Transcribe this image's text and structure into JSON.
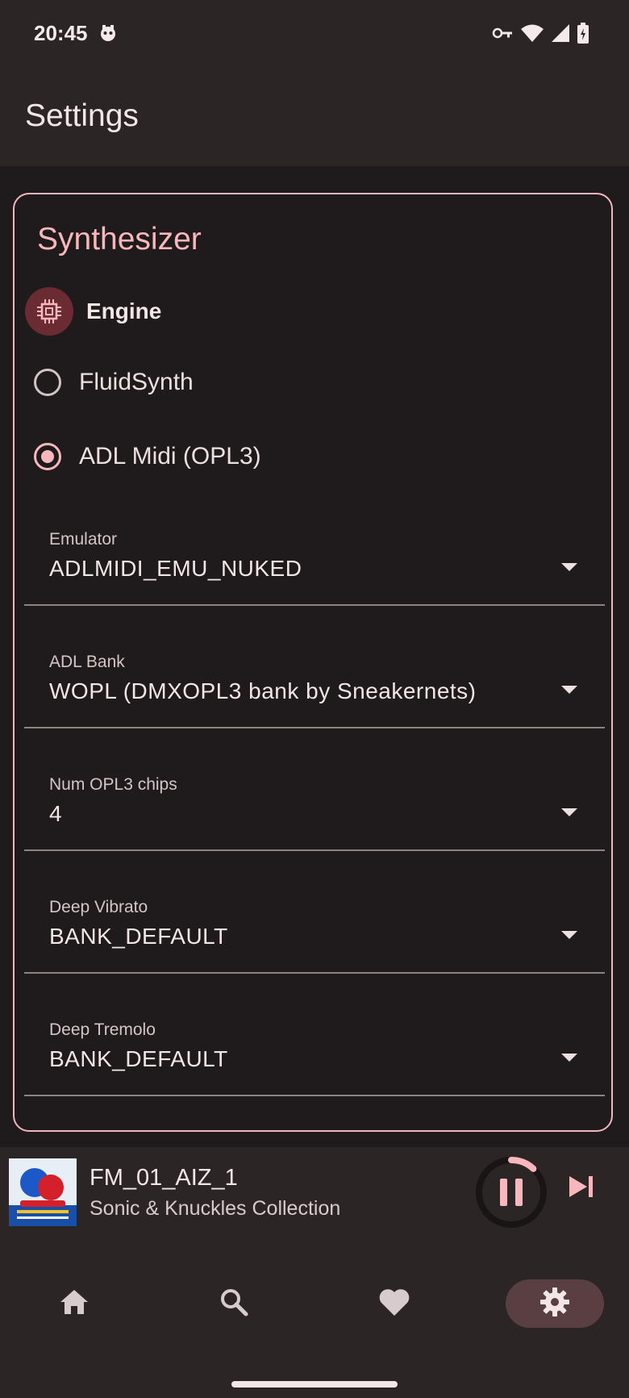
{
  "status_bar": {
    "time": "20:45"
  },
  "app_bar": {
    "title": "Settings"
  },
  "synth_card": {
    "title": "Synthesizer",
    "engine_label": "Engine",
    "engine_options": [
      {
        "label": "FluidSynth",
        "selected": false
      },
      {
        "label": "ADL Midi (OPL3)",
        "selected": true
      }
    ],
    "dropdowns": [
      {
        "label": "Emulator",
        "value": "ADLMIDI_EMU_NUKED"
      },
      {
        "label": "ADL Bank",
        "value": "WOPL (DMXOPL3 bank by Sneakernets)"
      },
      {
        "label": "Num OPL3 chips",
        "value": "4"
      },
      {
        "label": "Deep Vibrato",
        "value": "BANK_DEFAULT"
      },
      {
        "label": "Deep Tremolo",
        "value": "BANK_DEFAULT"
      }
    ]
  },
  "now_playing": {
    "track_title": "FM_01_AIZ_1",
    "album": "Sonic & Knuckles Collection",
    "album_art_icon": "album-art",
    "progress_fraction": 0.12
  },
  "bottom_nav": {
    "items": [
      {
        "icon": "home-icon",
        "active": false
      },
      {
        "icon": "search-icon",
        "active": false
      },
      {
        "icon": "heart-icon",
        "active": false
      },
      {
        "icon": "gear-icon",
        "active": true
      }
    ]
  },
  "colors": {
    "accent": "#f7b7bd",
    "background": "#1f1a1b",
    "surface": "#2c2526"
  }
}
